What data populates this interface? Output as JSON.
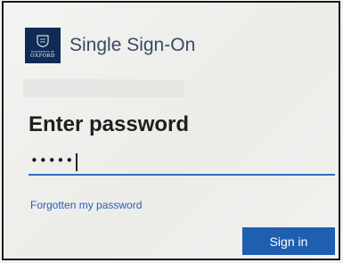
{
  "header": {
    "logo_top": "UNIVERSITY OF",
    "logo_main": "OXFORD",
    "title": "Single Sign-On"
  },
  "form": {
    "heading": "Enter password",
    "password_value": "•••••",
    "forgot_link": "Forgotten my password",
    "signin_label": "Sign in"
  },
  "colors": {
    "brand_navy": "#0f2b55",
    "accent_blue": "#1f5fb0",
    "link_blue": "#2a5db5"
  }
}
